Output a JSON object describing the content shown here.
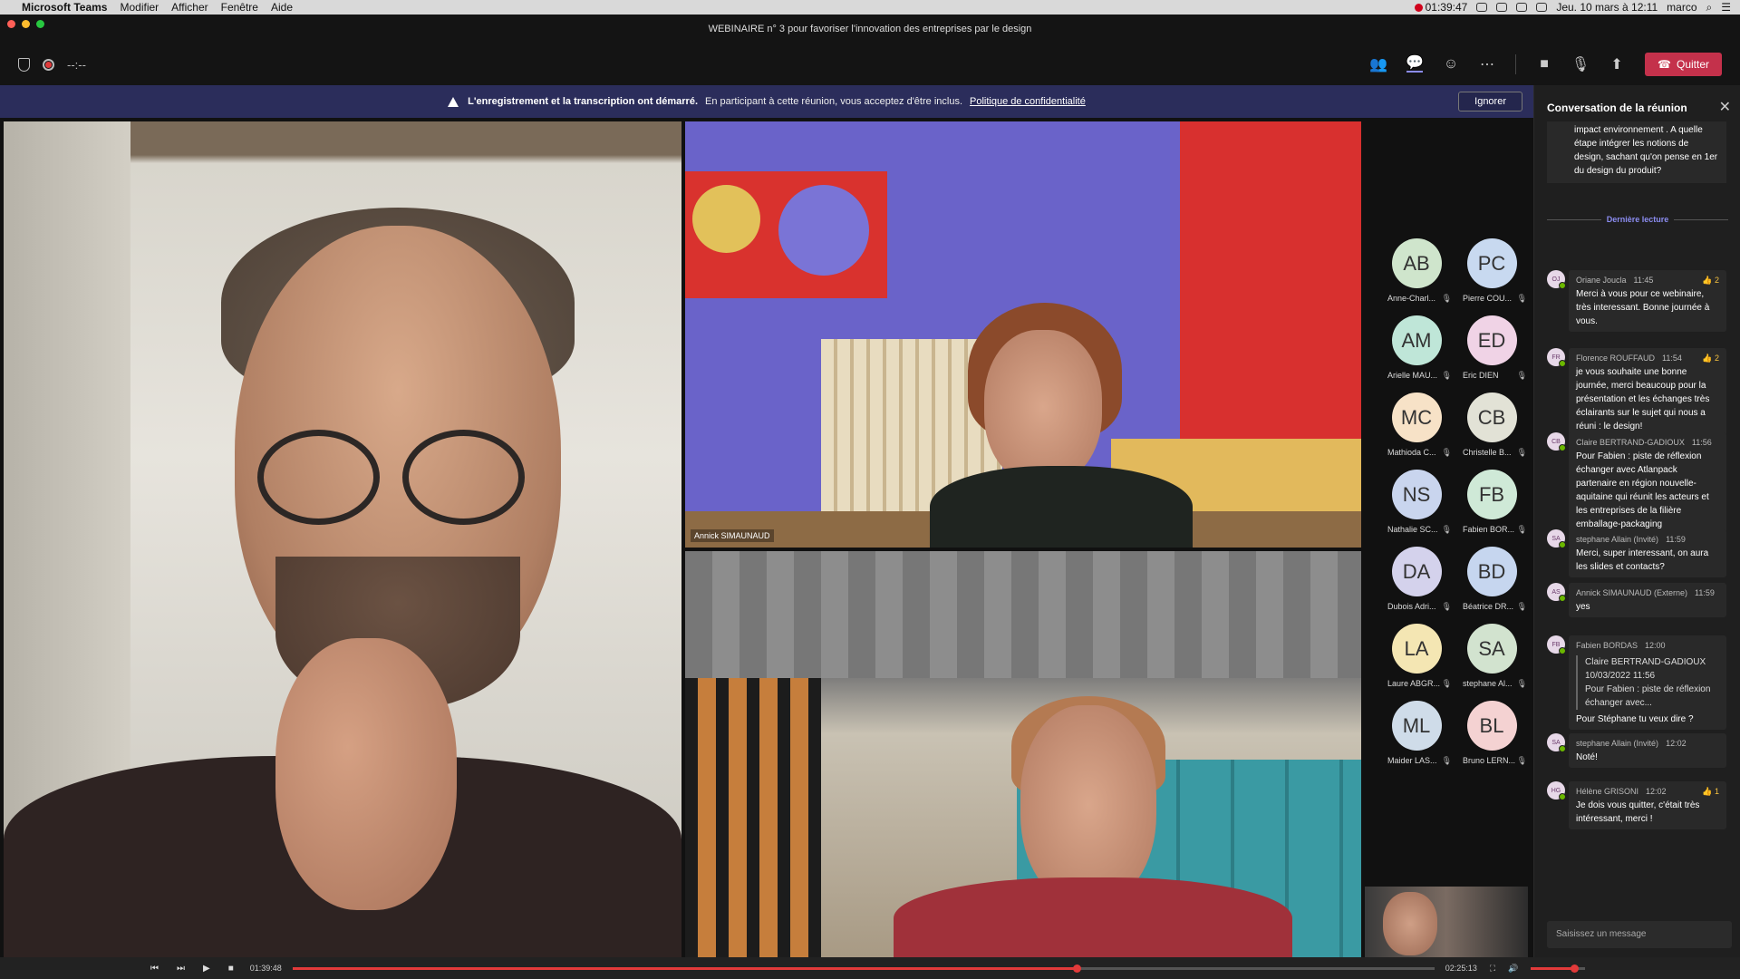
{
  "menubar": {
    "app_name": "Microsoft Teams",
    "menus": [
      "Modifier",
      "Afficher",
      "Fenêtre",
      "Aide"
    ],
    "rec_time": "01:39:47",
    "datetime": "Jeu. 10 mars à 12:11",
    "user": "marco"
  },
  "window": {
    "title": "WEBINAIRE n° 3 pour favoriser l'innovation des entreprises par le design"
  },
  "toolbar": {
    "timer": "--:--",
    "quit_label": "Quitter"
  },
  "banner": {
    "bold": "L'enregistrement et la transcription ont démarré.",
    "text": "En participant à cette réunion, vous acceptez d'être inclus.",
    "link": "Politique de confidentialité",
    "ignore": "Ignorer"
  },
  "stage": {
    "tile_a_name": "Annick SIMAUNAUD"
  },
  "roster": [
    {
      "initials": "AB",
      "name": "Anne-Charl...",
      "color": "#cfe5cc"
    },
    {
      "initials": "PC",
      "name": "Pierre COU...",
      "color": "#c8d9f0"
    },
    {
      "initials": "AM",
      "name": "Arielle MAU...",
      "color": "#bfe6d8"
    },
    {
      "initials": "ED",
      "name": "Eric DIEN",
      "color": "#f0d3e6"
    },
    {
      "initials": "MC",
      "name": "Mathioda C...",
      "color": "#f7e2c7"
    },
    {
      "initials": "CB",
      "name": "Christelle B...",
      "color": "#e2e2d6"
    },
    {
      "initials": "NS",
      "name": "Nathalie SC...",
      "color": "#c9d5ee"
    },
    {
      "initials": "FB",
      "name": "Fabien BOR...",
      "color": "#cfe9d7"
    },
    {
      "initials": "DA",
      "name": "Dubois Adri...",
      "color": "#d4d2ec"
    },
    {
      "initials": "BD",
      "name": "Béatrice DR...",
      "color": "#c6d6ef"
    },
    {
      "initials": "LA",
      "name": "Laure ABGR...",
      "color": "#f4e6b3"
    },
    {
      "initials": "SA",
      "name": "stephane Al...",
      "color": "#d2e3cf"
    },
    {
      "initials": "ML",
      "name": "Maider LAS...",
      "color": "#cfdce9"
    },
    {
      "initials": "BL",
      "name": "Bruno LERN...",
      "color": "#f4d2d2"
    }
  ],
  "chat": {
    "title": "Conversation de la réunion",
    "top_quote": "impact environnement . A quelle étape intégrer les notions de design, sachant qu'on pense en 1er du design du produit?",
    "divider": "Dernière lecture",
    "messages": [
      {
        "initials": "OJ",
        "author": "Oriane Joucla",
        "time": "11:45",
        "react": "👍 2",
        "text": "Merci à vous pour ce webinaire, très interessant. Bonne journée à vous."
      },
      {
        "initials": "FR",
        "author": "Florence ROUFFAUD",
        "time": "11:54",
        "react": "👍 2",
        "text": "je vous souhaite une bonne journée, merci beaucoup pour la présentation et les échanges très éclairants sur le sujet qui nous a réuni : le design!"
      },
      {
        "initials": "CB",
        "author": "Claire BERTRAND-GADIOUX",
        "time": "11:56",
        "react": "",
        "text": "Pour Fabien : piste de réflexion échanger avec Atlanpack partenaire en région nouvelle-aquitaine qui réunit les acteurs et les entreprises de la filière emballage-packaging"
      },
      {
        "initials": "SA",
        "author": "stephane Allain (Invité)",
        "time": "11:59",
        "react": "",
        "text": "Merci, super interessant, on aura les slides et contacts?"
      },
      {
        "initials": "AS",
        "author": "Annick SIMAUNAUD (Externe)",
        "time": "11:59",
        "react": "",
        "text": "yes"
      },
      {
        "initials": "FB",
        "author": "Fabien BORDAS",
        "time": "12:00",
        "react": "",
        "quote_author": "Claire BERTRAND-GADIOUX",
        "quote_date": "10/03/2022 11:56",
        "quote_text": "Pour Fabien : piste de réflexion échanger avec...",
        "text": "Pour Stéphane tu veux dire ?"
      },
      {
        "initials": "SA",
        "author": "stephane Allain (Invité)",
        "time": "12:02",
        "react": "",
        "text": "Noté!"
      },
      {
        "initials": "HG",
        "author": "Hélène GRISONI",
        "time": "12:02",
        "react": "👍 1",
        "text": "Je dois vous quitter, c'était très intéressant, merci !"
      }
    ],
    "compose_placeholder": "Saisissez un message"
  },
  "player": {
    "current": "01:39:48",
    "total": "02:25:13",
    "progress": 0.687,
    "volume": 0.8
  }
}
